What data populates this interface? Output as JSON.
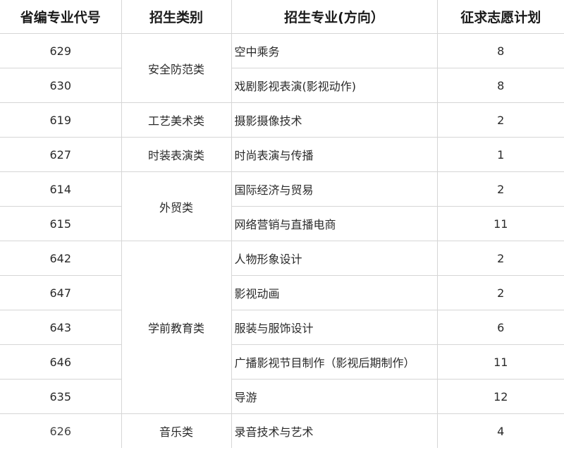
{
  "headers": {
    "code": "省编专业代号",
    "category": "招生类别",
    "major": "招生专业(方向）",
    "plan": "征求志愿计划"
  },
  "categories": [
    "安全防范类",
    "工艺美术类",
    "时装表演类",
    "外贸类",
    "学前教育类",
    "音乐类"
  ],
  "rows": [
    {
      "code": "629",
      "major": "空中乘务",
      "plan": "8"
    },
    {
      "code": "630",
      "major": "戏剧影视表演(影视动作)",
      "plan": "8"
    },
    {
      "code": "619",
      "major": "摄影摄像技术",
      "plan": "2"
    },
    {
      "code": "627",
      "major": "时尚表演与传播",
      "plan": "1"
    },
    {
      "code": "614",
      "major": "国际经济与贸易",
      "plan": "2"
    },
    {
      "code": "615",
      "major": "网络营销与直播电商",
      "plan": "11"
    },
    {
      "code": "642",
      "major": "人物形象设计",
      "plan": "2"
    },
    {
      "code": "647",
      "major": "影视动画",
      "plan": "2"
    },
    {
      "code": "643",
      "major": "服装与服饰设计",
      "plan": "6"
    },
    {
      "code": "646",
      "major": "广播影视节目制作（影视后期制作）",
      "plan": "11"
    },
    {
      "code": "635",
      "major": "导游",
      "plan": "12"
    },
    {
      "code": "626",
      "major": "录音技术与艺术",
      "plan": "4"
    }
  ]
}
